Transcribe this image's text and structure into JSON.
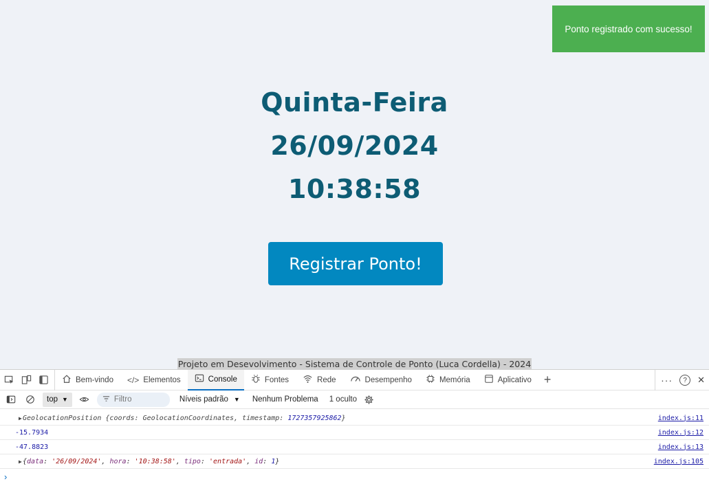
{
  "toast": {
    "message": "Ponto registrado com sucesso!"
  },
  "clock": {
    "weekday": "Quinta-Feira",
    "date": "26/09/2024",
    "time": "10:38:58"
  },
  "register_button": {
    "label": "Registrar Ponto!"
  },
  "footer": {
    "text": "Projeto em Desevolvimento - Sistema de Controle de Ponto (Luca Cordella) - 2024"
  },
  "devtools": {
    "tabs": [
      {
        "label": "Bem-vindo",
        "icon": "home-icon"
      },
      {
        "label": "Elementos",
        "icon": "code-icon"
      },
      {
        "label": "Console",
        "icon": "console-icon"
      },
      {
        "label": "Fontes",
        "icon": "bug-icon"
      },
      {
        "label": "Rede",
        "icon": "wifi-icon"
      },
      {
        "label": "Desempenho",
        "icon": "gauge-icon"
      },
      {
        "label": "Memória",
        "icon": "chip-icon"
      },
      {
        "label": "Aplicativo",
        "icon": "window-icon"
      }
    ],
    "active_tab": "Console",
    "toolbar": {
      "context": "top",
      "filter_placeholder": "Filtro",
      "levels": "Níveis padrão",
      "issues": "Nenhum Problema",
      "hidden": "1 oculto"
    },
    "logs": [
      {
        "type": "object",
        "text_prefix": "GeolocationPosition {coords: GeolocationCoordinates, timestamp: ",
        "text_num": "1727357925862",
        "text_suffix": "}",
        "source": "index.js:11"
      },
      {
        "type": "number",
        "text": "-15.7934",
        "source": "index.js:12"
      },
      {
        "type": "number",
        "text": "-47.8823",
        "source": "index.js:13"
      },
      {
        "type": "object",
        "parts": {
          "data": "'26/09/2024'",
          "hora": "'10:38:58'",
          "tipo": "'entrada'",
          "id": "1"
        },
        "source": "index.js:105"
      }
    ]
  },
  "colors": {
    "toast": "#4caf50",
    "clock_text": "#0d5c74",
    "button": "#0288c0",
    "background": "#eff2f7"
  }
}
